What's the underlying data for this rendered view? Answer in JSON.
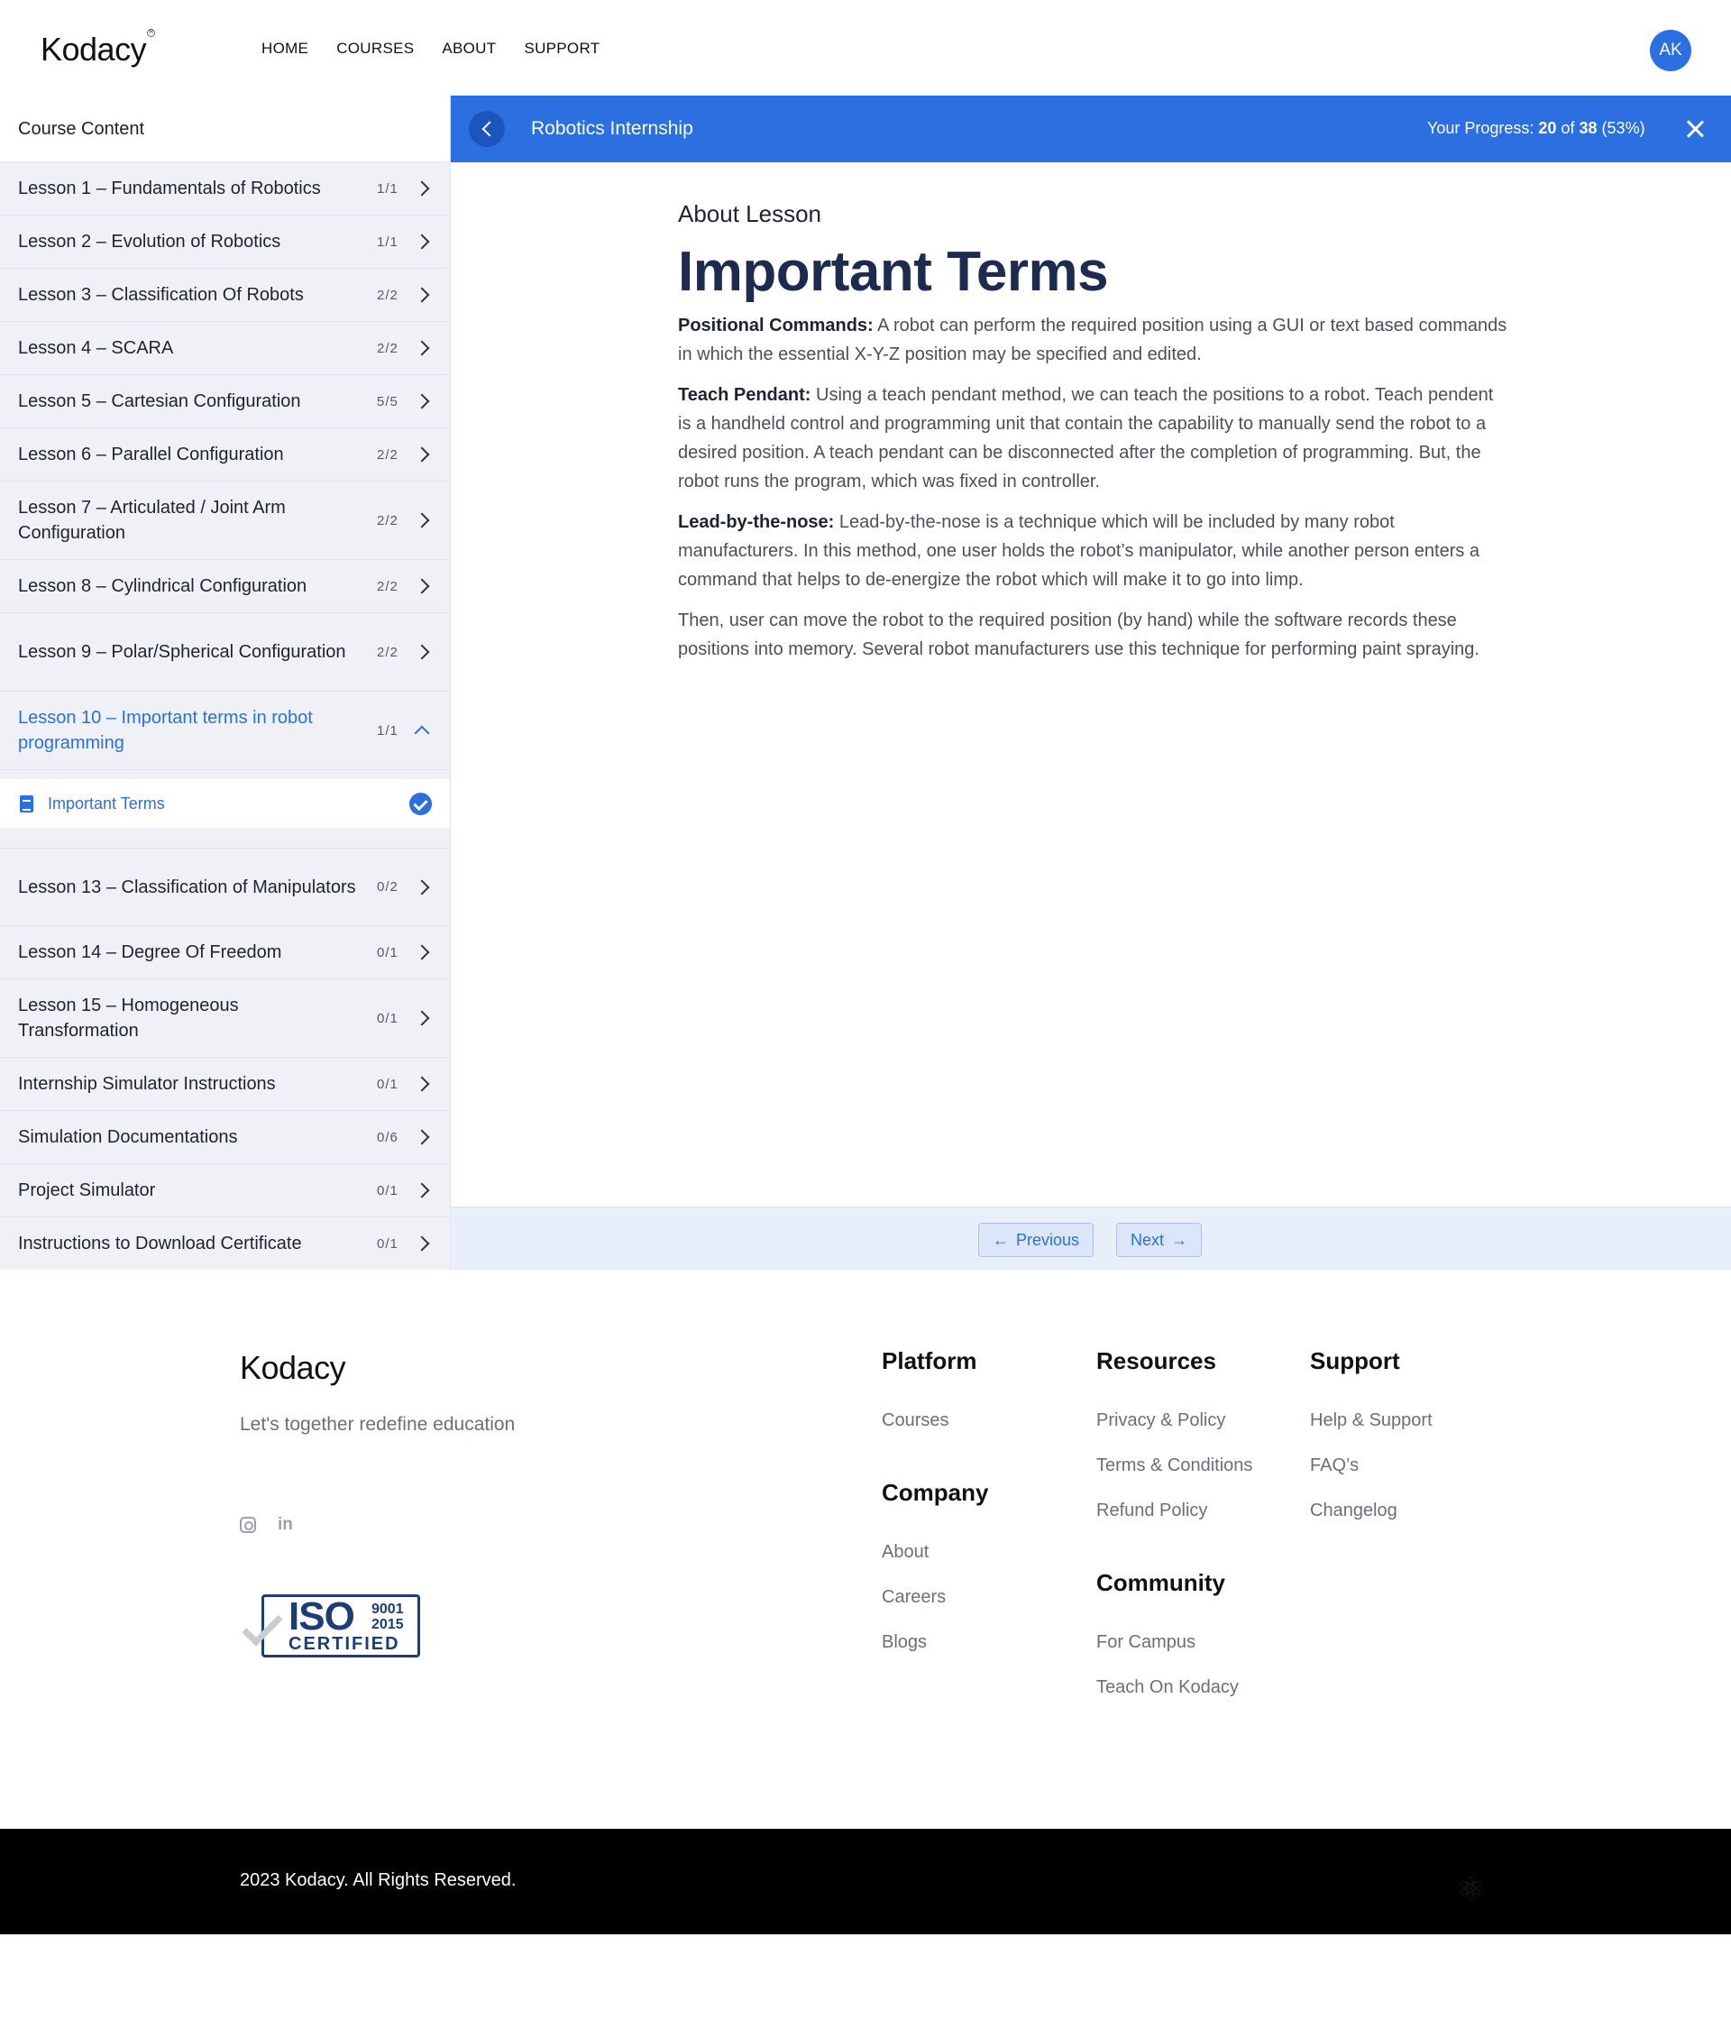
{
  "header": {
    "logo": "Kodacy",
    "nav": [
      "HOME",
      "COURSES",
      "ABOUT",
      "SUPPORT"
    ],
    "avatar_initials": "AK"
  },
  "sidebar": {
    "title": "Course Content",
    "lessons": [
      {
        "title": "Lesson 1 – Fundamentals of Robotics",
        "count": "1/1"
      },
      {
        "title": "Lesson 2 – Evolution of Robotics",
        "count": "1/1"
      },
      {
        "title": "Lesson 3 – Classification Of Robots",
        "count": "2/2"
      },
      {
        "title": "Lesson 4 – SCARA",
        "count": "2/2"
      },
      {
        "title": "Lesson 5 – Cartesian Configuration",
        "count": "5/5"
      },
      {
        "title": "Lesson 6 – Parallel Configuration",
        "count": "2/2"
      },
      {
        "title": "Lesson 7 – Articulated / Joint Arm Configuration",
        "count": "2/2"
      },
      {
        "title": "Lesson 8 – Cylindrical Configuration",
        "count": "2/2"
      },
      {
        "title": "Lesson 9 – Polar/Spherical Configuration",
        "count": "2/2"
      },
      {
        "title": "Lesson 10 – Important terms in robot programming",
        "count": "1/1"
      },
      {
        "title": "Lesson 13 – Classification of Manipulators",
        "count": "0/2"
      },
      {
        "title": "Lesson 14 – Degree Of Freedom",
        "count": "0/1"
      },
      {
        "title": "Lesson 15 – Homogeneous Transformation",
        "count": "0/1"
      },
      {
        "title": "Internship Simulator Instructions",
        "count": "0/1"
      },
      {
        "title": "Simulation Documentations",
        "count": "0/6"
      },
      {
        "title": "Project Simulator",
        "count": "0/1"
      },
      {
        "title": "Instructions to Download Certificate",
        "count": "0/1"
      }
    ],
    "active_subitem": "Important Terms"
  },
  "topbar": {
    "course_title": "Robotics Internship",
    "progress_label": "Your Progress:",
    "progress_done": "20",
    "progress_of": "of",
    "progress_total": "38",
    "progress_percent": "(53%)"
  },
  "lesson": {
    "kicker": "About Lesson",
    "title": "Important Terms",
    "paragraphs": [
      {
        "term": "Positional Commands:",
        "text": " A robot can perform the required position using a GUI or text based commands in which the essential X-Y-Z position may be specified and edited."
      },
      {
        "term": "Teach Pendant:",
        "text": " Using a teach pendant method, we can teach the positions to a robot. Teach pendent is a handheld control and programming unit that contain the capability to manually send the robot to a desired position. A teach pendant can be disconnected after the completion of programming. But, the robot runs the program, which was fixed in controller."
      },
      {
        "term": "Lead-by-the-nose:",
        "text": " Lead-by-the-nose is a technique which will be included by many robot manufacturers. In this method, one user holds the robot’s manipulator, while another person enters a command that helps to de-energize the robot which will make it to go into limp."
      },
      {
        "term": "",
        "text": "Then, user can move the robot to the required position (by hand) while the software records these positions into memory. Several robot manufacturers use this technique for performing paint spraying."
      }
    ]
  },
  "pager": {
    "previous": "Previous",
    "next": "Next"
  },
  "footer": {
    "logo": "Kodacy",
    "tagline": "Let's together redefine education",
    "iso": {
      "word": "ISO",
      "num1": "9001",
      "num2": "2015",
      "certified": "CERTIFIED"
    },
    "platform": {
      "title": "Platform",
      "links": [
        "Courses"
      ]
    },
    "company": {
      "title": "Company",
      "links": [
        "About",
        "Careers",
        "Blogs"
      ]
    },
    "resources": {
      "title": "Resources",
      "links": [
        "Privacy & Policy",
        "Terms & Conditions",
        "Refund Policy"
      ]
    },
    "community": {
      "title": "Community",
      "links": [
        "For Campus",
        "Teach On Kodacy"
      ]
    },
    "support": {
      "title": "Support",
      "links": [
        "Help & Support",
        "FAQ’s",
        "Changelog"
      ]
    },
    "copyright": "2023 Kodacy. All Rights Reserved."
  }
}
